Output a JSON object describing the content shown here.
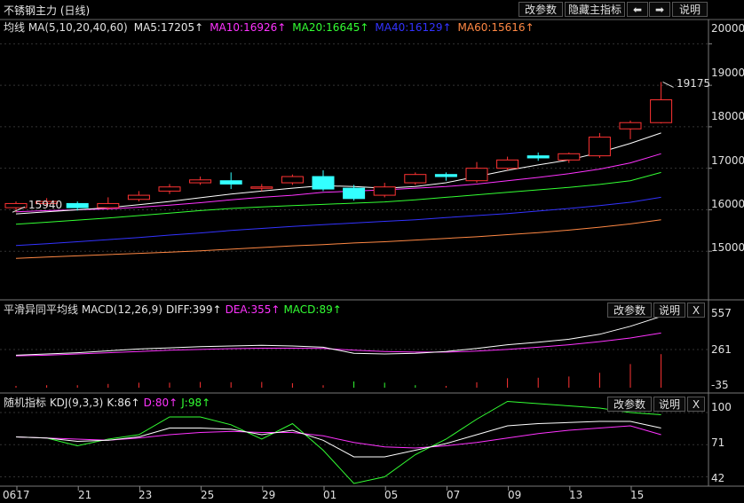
{
  "window": {
    "title": "不锈钢主力 (日线)",
    "buttons": {
      "params": "改参数",
      "hide_main": "隐藏主指标",
      "back": "⬅",
      "forward": "➡",
      "help": "说明"
    }
  },
  "colors": {
    "bg": "#000000",
    "ma5": "#ffffff",
    "ma10": "#ff33ff",
    "ma20": "#33ff33",
    "ma40": "#3333ff",
    "ma60": "#ff8844",
    "up": "#ff3333",
    "down": "#33ffff"
  },
  "main": {
    "legend": {
      "head": "均线 MA(5,10,20,40,60)",
      "ma5": "MA5:17205↑",
      "ma10": "MA10:16926↑",
      "ma20": "MA20:16645↑",
      "ma40": "MA40:16129↑",
      "ma60": "MA60:15616↑"
    },
    "yticks": [
      "20000",
      "19000",
      "18000",
      "17000",
      "16000",
      "15000"
    ],
    "low_label": "15940",
    "high_label": "19175"
  },
  "macd": {
    "legend": {
      "head": "平滑异同平均线 MACD(12,26,9)",
      "diff": "DIFF:399↑",
      "dea": "DEA:355↑",
      "macd": "MACD:89↑"
    },
    "buttons": {
      "params": "改参数",
      "help": "说明",
      "close": "X"
    },
    "yticks": [
      "557",
      "261",
      "-35"
    ]
  },
  "kdj": {
    "legend": {
      "head": "随机指标 KDJ(9,3,3)",
      "k": "K:86↑",
      "d": "D:80↑",
      "j": "J:98↑"
    },
    "buttons": {
      "params": "改参数",
      "help": "说明",
      "close": "X"
    },
    "yticks": [
      "100",
      "71",
      "42"
    ]
  },
  "xaxis": [
    "0617",
    "21",
    "23",
    "25",
    "29",
    "01",
    "05",
    "07",
    "09",
    "13",
    "15"
  ],
  "chart_data": {
    "type": "candlestick",
    "title": "不锈钢主力 (日线)",
    "candles": [
      {
        "o": 16050,
        "c": 16150,
        "h": 16200,
        "l": 15940
      },
      {
        "o": 16150,
        "c": 16200,
        "h": 16280,
        "l": 16050
      },
      {
        "o": 16150,
        "c": 16050,
        "h": 16200,
        "l": 15980
      },
      {
        "o": 16050,
        "c": 16150,
        "h": 16300,
        "l": 16000
      },
      {
        "o": 16250,
        "c": 16350,
        "h": 16450,
        "l": 16200
      },
      {
        "o": 16450,
        "c": 16550,
        "h": 16620,
        "l": 16380
      },
      {
        "o": 16650,
        "c": 16720,
        "h": 16800,
        "l": 16600
      },
      {
        "o": 16700,
        "c": 16620,
        "h": 16900,
        "l": 16500
      },
      {
        "o": 16550,
        "c": 16550,
        "h": 16620,
        "l": 16450
      },
      {
        "o": 16650,
        "c": 16800,
        "h": 16850,
        "l": 16600
      },
      {
        "o": 16800,
        "c": 16500,
        "h": 16950,
        "l": 16450
      },
      {
        "o": 16520,
        "c": 16270,
        "h": 16600,
        "l": 16220
      },
      {
        "o": 16350,
        "c": 16550,
        "h": 16650,
        "l": 16300
      },
      {
        "o": 16650,
        "c": 16850,
        "h": 16900,
        "l": 16600
      },
      {
        "o": 16850,
        "c": 16800,
        "h": 16900,
        "l": 16700
      },
      {
        "o": 16700,
        "c": 17000,
        "h": 17150,
        "l": 16650
      },
      {
        "o": 17000,
        "c": 17200,
        "h": 17280,
        "l": 16950
      },
      {
        "o": 17300,
        "c": 17250,
        "h": 17380,
        "l": 17180
      },
      {
        "o": 17200,
        "c": 17350,
        "h": 17380,
        "l": 17130
      },
      {
        "o": 17300,
        "c": 17750,
        "h": 17850,
        "l": 17250
      },
      {
        "o": 17950,
        "c": 18100,
        "h": 18150,
        "l": 17700
      },
      {
        "o": 18100,
        "c": 18650,
        "h": 19080,
        "l": 18080
      }
    ],
    "ma5": [
      15900,
      15950,
      16000,
      16050,
      16120,
      16200,
      16290,
      16380,
      16450,
      16520,
      16580,
      16560,
      16520,
      16560,
      16650,
      16800,
      16950,
      17080,
      17200,
      17380,
      17600,
      17850
    ],
    "ma10": [
      15950,
      15980,
      16000,
      16020,
      16060,
      16110,
      16170,
      16240,
      16300,
      16350,
      16420,
      16450,
      16480,
      16520,
      16560,
      16620,
      16700,
      16780,
      16870,
      16980,
      17130,
      17350
    ],
    "ma20": [
      15650,
      15700,
      15750,
      15800,
      15860,
      15920,
      15980,
      16030,
      16070,
      16100,
      16130,
      16160,
      16190,
      16240,
      16300,
      16360,
      16420,
      16480,
      16540,
      16610,
      16700,
      16900
    ],
    "ma40": [
      15140,
      15180,
      15230,
      15280,
      15330,
      15390,
      15440,
      15500,
      15550,
      15600,
      15640,
      15680,
      15720,
      15760,
      15810,
      15860,
      15910,
      15970,
      16030,
      16100,
      16180,
      16300
    ],
    "ma60": [
      14830,
      14860,
      14890,
      14920,
      14950,
      14980,
      15010,
      15050,
      15090,
      15130,
      15160,
      15200,
      15230,
      15270,
      15310,
      15350,
      15400,
      15450,
      15510,
      15580,
      15660,
      15760
    ],
    "ylim": [
      14000,
      20200
    ],
    "macd_diff": [
      215,
      225,
      235,
      250,
      265,
      275,
      285,
      290,
      295,
      290,
      280,
      230,
      225,
      230,
      245,
      270,
      300,
      320,
      345,
      385,
      450,
      530
    ],
    "macd_dea": [
      210,
      215,
      225,
      235,
      245,
      255,
      262,
      268,
      272,
      272,
      270,
      255,
      245,
      240,
      240,
      248,
      262,
      280,
      300,
      325,
      355,
      395
    ],
    "macd_hist": [
      5,
      10,
      10,
      15,
      20,
      20,
      23,
      22,
      23,
      18,
      10,
      -25,
      -20,
      -10,
      5,
      22,
      38,
      40,
      45,
      60,
      95,
      135
    ],
    "macd_ylim": [
      -35,
      557
    ],
    "kdj_k": [
      78,
      77,
      74,
      75,
      78,
      86,
      86,
      85,
      80,
      84,
      75,
      60,
      60,
      66,
      72,
      80,
      88,
      90,
      91,
      92,
      92,
      86
    ],
    "kdj_d": [
      78,
      77,
      76,
      75,
      77,
      80,
      82,
      83,
      82,
      82,
      79,
      73,
      69,
      68,
      70,
      73,
      77,
      81,
      84,
      86,
      88,
      80
    ],
    "kdj_j": [
      78,
      77,
      70,
      76,
      80,
      96,
      96,
      89,
      76,
      90,
      66,
      36,
      42,
      62,
      76,
      94,
      110,
      108,
      106,
      104,
      100,
      98
    ],
    "kdj_ylim": [
      36,
      108
    ]
  }
}
